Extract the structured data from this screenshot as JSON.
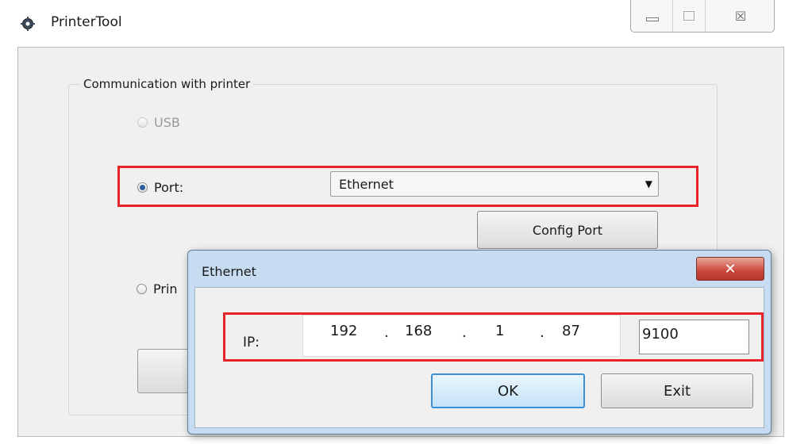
{
  "app": {
    "title": "PrinterTool",
    "icon": "gear-icon"
  },
  "window_controls": {
    "minimize_icon": "minimize-icon",
    "maximize_icon": "maximize-icon",
    "close_glyph": "☒"
  },
  "communication": {
    "legend": "Communication with printer",
    "usb": {
      "label": "USB",
      "selected": false,
      "enabled": false
    },
    "port": {
      "label": "Port:",
      "selected": true,
      "value": "Ethernet",
      "arrow": "▼"
    },
    "config_button": "Config Port",
    "printer_partial_label": "Prin"
  },
  "ethernet_dialog": {
    "title": "Ethernet",
    "close_glyph": "✕",
    "ip_label": "IP:",
    "ip": [
      "192",
      "168",
      "1",
      "87"
    ],
    "separator": ".",
    "port_value": "9100",
    "ok_label": "OK",
    "exit_label": "Exit"
  },
  "colors": {
    "highlight": "#e8232a",
    "dialog_frame": "#c7dcf1",
    "ok_border": "#3c8fd2"
  }
}
